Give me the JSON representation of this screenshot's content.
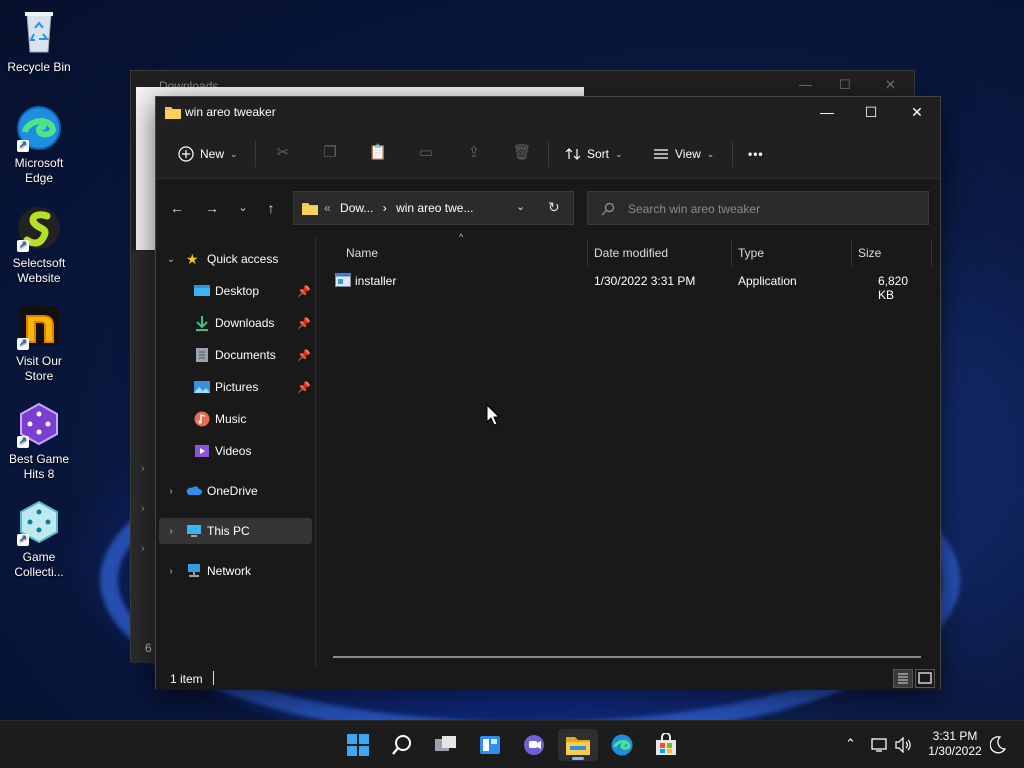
{
  "desktop": {
    "icons": [
      {
        "label": "Recycle Bin"
      },
      {
        "label": "Microsoft Edge"
      },
      {
        "label": "Selectsoft Website"
      },
      {
        "label": "Visit Our Store"
      },
      {
        "label": "Best Game Hits 8"
      },
      {
        "label": "Game Collecti..."
      }
    ]
  },
  "background_window": {
    "title": "Downloads",
    "footer": "6 i"
  },
  "window": {
    "title": "win areo tweaker",
    "toolbar": {
      "new_label": "New",
      "sort_label": "Sort",
      "view_label": "View",
      "more_label": "•••"
    },
    "address": {
      "prefix": "«",
      "crumb1": "Dow...",
      "sep": "›",
      "crumb2": "win areo twe..."
    },
    "search": {
      "placeholder": "Search win areo tweaker"
    },
    "nav": {
      "quick_access": "Quick access",
      "desktop": "Desktop",
      "downloads": "Downloads",
      "documents": "Documents",
      "pictures": "Pictures",
      "music": "Music",
      "videos": "Videos",
      "onedrive": "OneDrive",
      "this_pc": "This PC",
      "network": "Network"
    },
    "columns": {
      "name": "Name",
      "date_modified": "Date modified",
      "type": "Type",
      "size": "Size"
    },
    "files": [
      {
        "name": "installer",
        "date_modified": "1/30/2022 3:31 PM",
        "type": "Application",
        "size": "6,820 KB"
      }
    ],
    "status": {
      "count": "1 item"
    }
  },
  "taskbar": {
    "time": "3:31 PM",
    "date": "1/30/2022"
  }
}
